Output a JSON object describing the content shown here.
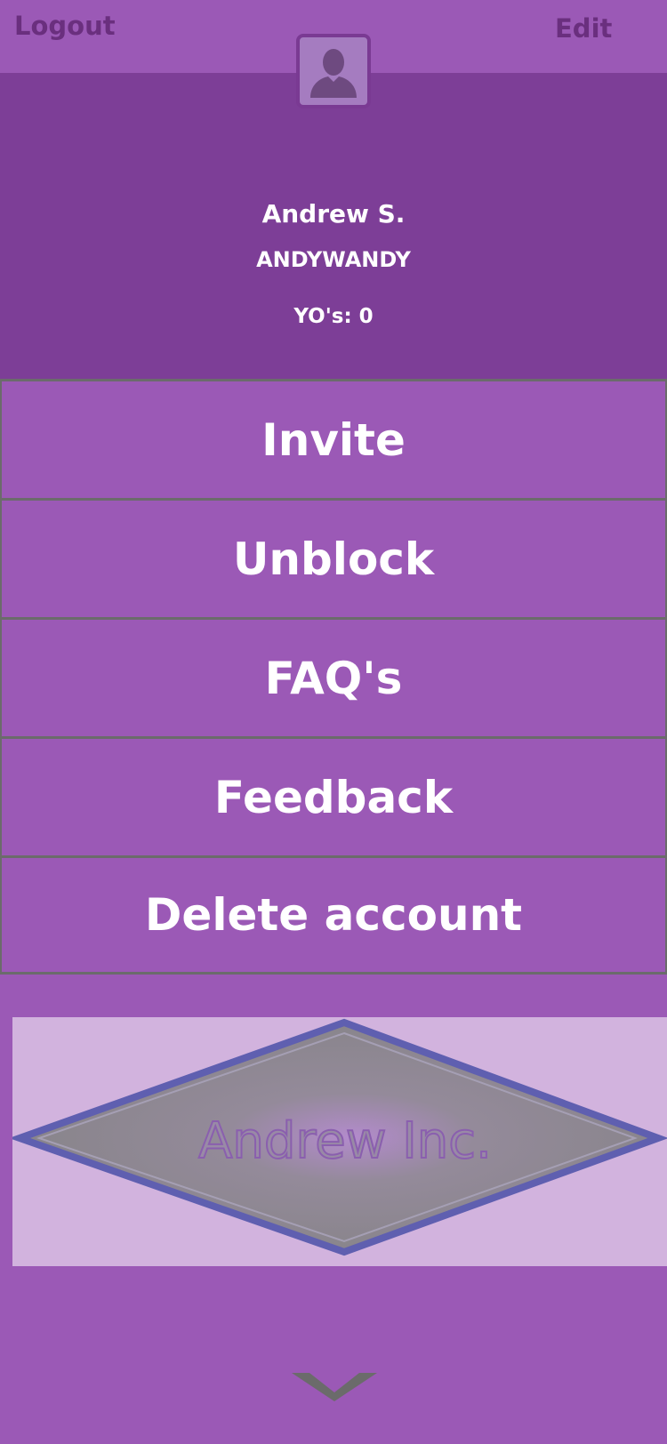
{
  "topbar": {
    "logout_label": "Logout",
    "edit_label": "Edit"
  },
  "profile": {
    "avatar_icon": "person-silhouette-icon",
    "name": "Andrew S.",
    "username": "ANDYWANDY",
    "yos": "YO's: 0"
  },
  "menu": {
    "items": [
      {
        "label": "Invite"
      },
      {
        "label": "Unblock"
      },
      {
        "label": "FAQ's"
      },
      {
        "label": "Feedback"
      },
      {
        "label": "Delete account"
      }
    ]
  },
  "banner": {
    "text": "Andrew Inc."
  },
  "footer": {
    "icon": "chevron-down-icon"
  },
  "colors": {
    "primary": "#9b59b6",
    "header": "#7d3e97",
    "banner_bg": "#d2b3de",
    "diamond_border": "#5f5fb0",
    "diamond_fill": "#8e8792",
    "topbar_text": "#6a2f7e"
  }
}
